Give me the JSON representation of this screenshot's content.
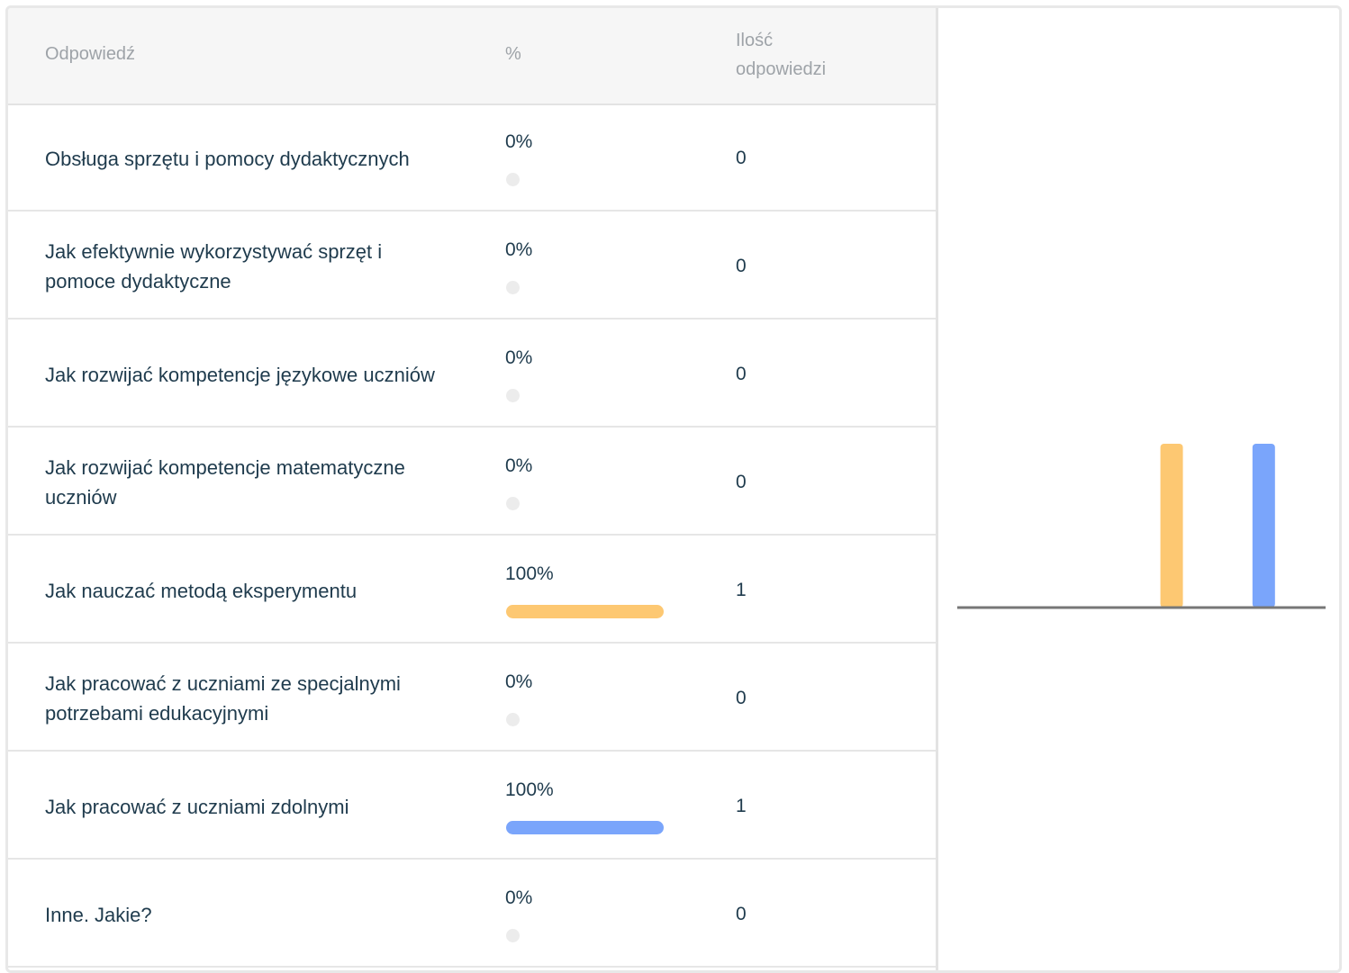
{
  "header": {
    "answer": "Odpowiedź",
    "percent": "%",
    "count_line1": "Ilość",
    "count_line2": "odpowiedzi"
  },
  "rows": [
    {
      "answer": "Obsługa sprzętu i pomocy dydaktycznych",
      "percent": "0%",
      "count": "0"
    },
    {
      "answer": "Jak efektywnie wykorzystywać sprzęt i pomoce dydaktyczne",
      "percent": "0%",
      "count": "0"
    },
    {
      "answer": "Jak rozwijać kompetencje językowe uczniów",
      "percent": "0%",
      "count": "0"
    },
    {
      "answer": "Jak rozwijać kompetencje matematyczne uczniów",
      "percent": "0%",
      "count": "0"
    },
    {
      "answer": "Jak nauczać metodą eksperymentu",
      "percent": "100%",
      "count": "1"
    },
    {
      "answer": "Jak pracować z uczniami ze specjalnymi potrzebami edukacyjnymi",
      "percent": "0%",
      "count": "0"
    },
    {
      "answer": "Jak pracować z uczniami zdolnymi",
      "percent": "100%",
      "count": "1"
    },
    {
      "answer": "Inne. Jakie?",
      "percent": "0%",
      "count": "0"
    }
  ],
  "colors": {
    "bar_orange": "#fdc872",
    "bar_blue": "#7aa5fb",
    "axis": "#777777",
    "empty_dot": "#ececec"
  },
  "chart_data": {
    "type": "bar",
    "categories": [
      "Obsługa sprzętu i pomocy dydaktycznych",
      "Jak efektywnie wykorzystywać sprzęt i pomoce dydaktyczne",
      "Jak rozwijać kompetencje językowe uczniów",
      "Jak rozwijać kompetencje matematyczne uczniów",
      "Jak nauczać metodą eksperymentu",
      "Jak pracować z uczniami ze specjalnymi potrzebami edukacyjnymi",
      "Jak pracować z uczniami zdolnymi",
      "Inne. Jakie?"
    ],
    "values": [
      0,
      0,
      0,
      0,
      1,
      0,
      1,
      0
    ],
    "percent": [
      0,
      0,
      0,
      0,
      100,
      0,
      100,
      0
    ],
    "bar_colors": [
      "#fdc872",
      "#fdc872",
      "#fdc872",
      "#fdc872",
      "#fdc872",
      "#7aa5fb",
      "#7aa5fb",
      "#7aa5fb"
    ],
    "title": "",
    "xlabel": "",
    "ylabel": "",
    "ylim": [
      0,
      1
    ],
    "grid": false,
    "legend": "none"
  }
}
